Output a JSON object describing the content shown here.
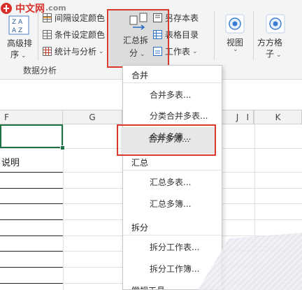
{
  "watermark": {
    "logo_text": "中文网",
    "domain": ".com"
  },
  "ribbon": {
    "sort_label_1": "高级排",
    "sort_label_2": "序",
    "interval_color": "间隔设定颜色",
    "condition_color": "条件设定颜色",
    "stats_analysis": "统计与分析",
    "group_label": "数据分析",
    "summary_split_1": "汇总拆",
    "summary_split_2": "分",
    "save_sheet": "另存本表",
    "sheet_directory": "表格目录",
    "worksheet": "工作表",
    "view": "视图",
    "square_grid_1": "方方格",
    "square_grid_2": "子"
  },
  "sheet": {
    "columns": [
      "F",
      "G",
      "I",
      "J",
      "K"
    ],
    "cell_text": "说明"
  },
  "menu": {
    "section_merge": "合并",
    "merge_sheets": "合并多表...",
    "merge_categories": "分类合并多表...",
    "merge_workbooks": "合并多簿...",
    "section_summary": "汇总",
    "summarize_sheets": "汇总多表...",
    "summarize_workbooks": "汇总多簿...",
    "section_split": "拆分",
    "split_worksheet": "拆分工作表...",
    "split_workbook": "拆分工作簿...",
    "section_tools": "常规工具"
  },
  "colors": {
    "highlight_border": "#d9382f",
    "selection_green": "#1e7145",
    "watermark_red": "#d8302a"
  }
}
